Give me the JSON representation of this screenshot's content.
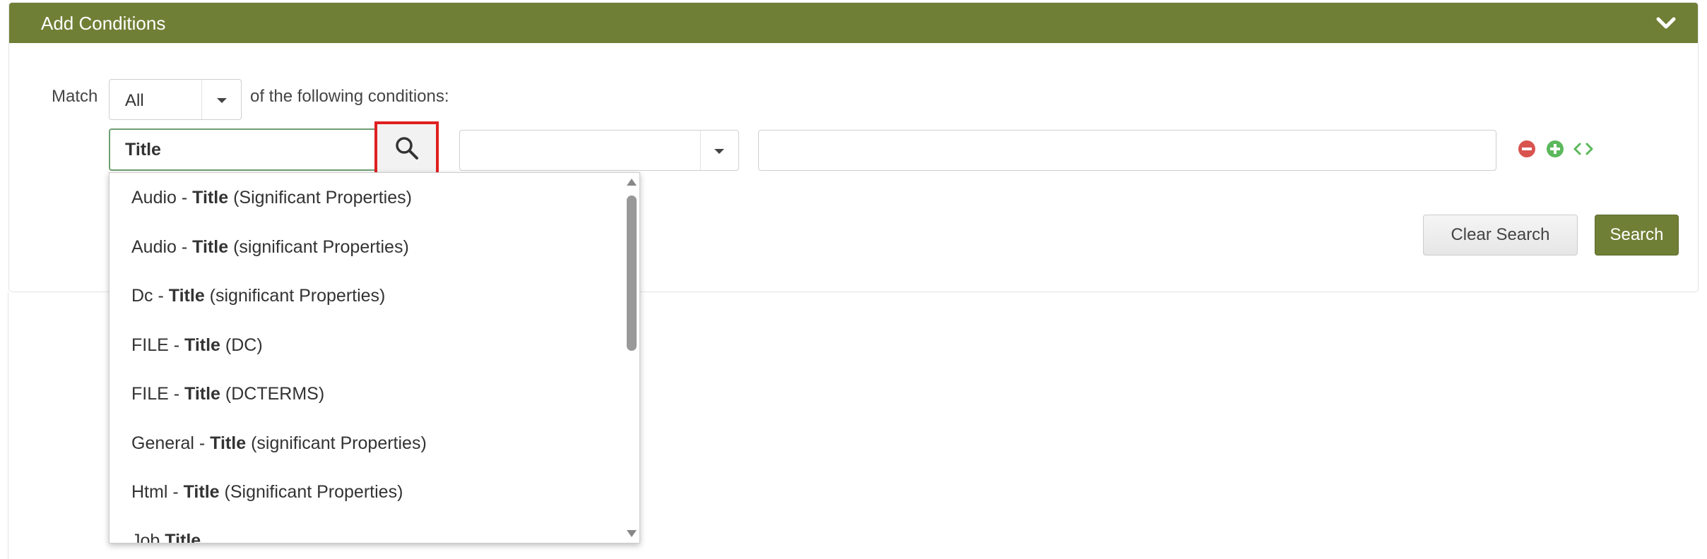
{
  "panel": {
    "title": "Add Conditions",
    "collapse_icon": "chevron-down-icon"
  },
  "match": {
    "label": "Match",
    "selected": "All",
    "suffix": "of the following conditions:"
  },
  "condition": {
    "field_value": "Title",
    "search_icon": "search-icon",
    "operator_value": "",
    "value_input": "",
    "remove_icon": "minus-circle-icon",
    "add_icon": "plus-circle-icon",
    "group_icon": "code-brackets-icon"
  },
  "buttons": {
    "clear": "Clear Search",
    "search": "Search"
  },
  "suggestions": [
    {
      "prefix": "Audio - ",
      "bold": "Title",
      "suffix": " (Significant Properties)"
    },
    {
      "prefix": "Audio - ",
      "bold": "Title",
      "suffix": " (significant Properties)"
    },
    {
      "prefix": "Dc - ",
      "bold": "Title",
      "suffix": " (significant Properties)"
    },
    {
      "prefix": "FILE - ",
      "bold": "Title",
      "suffix": " (DC)"
    },
    {
      "prefix": "FILE - ",
      "bold": "Title",
      "suffix": " (DCTERMS)"
    },
    {
      "prefix": "General - ",
      "bold": "Title",
      "suffix": " (significant Properties)"
    },
    {
      "prefix": "Html - ",
      "bold": "Title",
      "suffix": " (Significant Properties)"
    },
    {
      "prefix": "Job ",
      "bold": "Title",
      "suffix": ""
    }
  ],
  "colors": {
    "accent": "#6f7f35",
    "highlight_border": "#e02020",
    "remove": "#d9534f",
    "add": "#5cb85c"
  }
}
